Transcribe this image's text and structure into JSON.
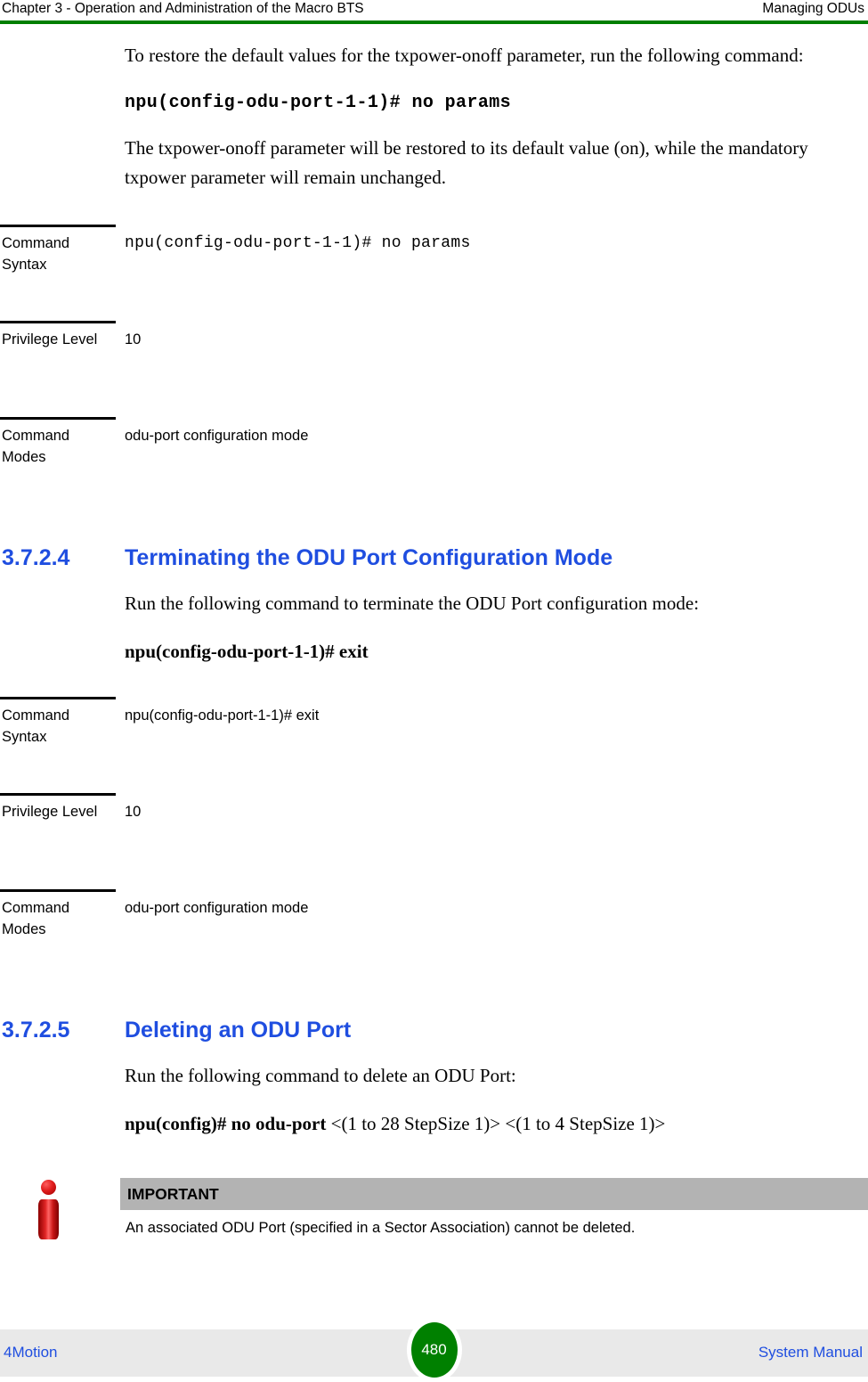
{
  "header": {
    "left": "Chapter 3 - Operation and Administration of the Macro BTS",
    "right": "Managing ODUs",
    "rule_color": "#007f00"
  },
  "intro": {
    "paragraph_1": "To restore the default values for the txpower-onoff parameter, run the following command:",
    "command": "npu(config-odu-port-1-1)# no params",
    "paragraph_2": "The txpower-onoff parameter will be restored to its default value (on), while the mandatory txpower parameter will remain unchanged."
  },
  "table_1": {
    "rows": [
      {
        "label": "Command Syntax",
        "value": "npu(config-odu-port-1-1)# no params",
        "value_style": "mono"
      },
      {
        "label": "Privilege Level",
        "value": "10",
        "value_style": "sans"
      },
      {
        "label": "Command Modes",
        "value": "odu-port configuration mode",
        "value_style": "sans"
      }
    ]
  },
  "section_3724": {
    "number": "3.7.2.4",
    "title": "Terminating the ODU Port Configuration Mode",
    "color": "#1f4ee0",
    "paragraph": "Run the following command to terminate the ODU Port configuration mode:",
    "command": "npu(config-odu-port-1-1)# exit"
  },
  "table_2": {
    "rows": [
      {
        "label": "Command Syntax",
        "value": "npu(config-odu-port-1-1)# exit",
        "value_style": "sans"
      },
      {
        "label": "Privilege Level",
        "value": "10",
        "value_style": "sans"
      },
      {
        "label": "Command Modes",
        "value": "odu-port configuration mode",
        "value_style": "sans"
      }
    ]
  },
  "section_3725": {
    "number": "3.7.2.5",
    "title": "Deleting an ODU Port",
    "color": "#1f4ee0",
    "paragraph": "Run the following command to delete an ODU Port:",
    "command_bold": "npu(config)# no odu-port",
    "command_rest": " <(1 to 28 StepSize 1)> <(1 to 4 StepSize 1)>"
  },
  "note": {
    "icon": "info-i-icon",
    "title": "IMPORTANT",
    "bar_color": "#b3b3b3",
    "body": "An associated ODU Port (specified in a Sector Association) cannot be deleted."
  },
  "footer": {
    "left": "4Motion",
    "page_number": "480",
    "right": "System Manual",
    "badge_color": "#008000",
    "band_color": "#e9e9e9"
  }
}
